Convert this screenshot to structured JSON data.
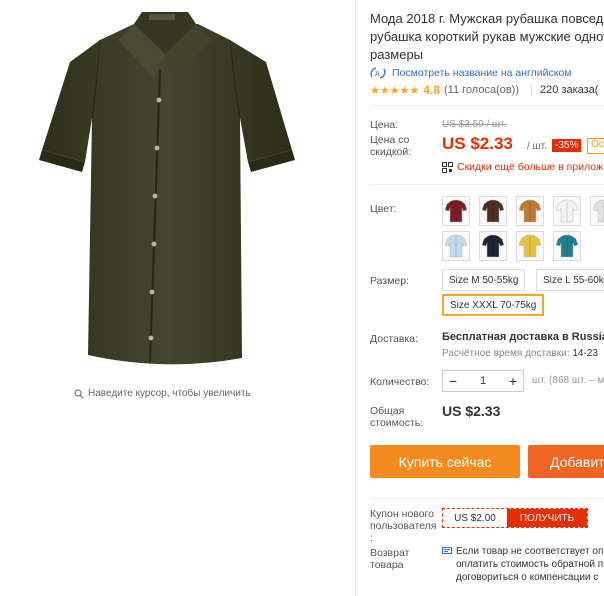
{
  "product": {
    "title_lines": [
      "Мода 2018 г. Мужская рубашка повседн",
      "рубашка короткий рукав мужские однот",
      "размеры"
    ],
    "view_english_label": "Посмотреть название на английском",
    "rating": "4.8",
    "votes": "(11 голоса(ов))",
    "orders": "220 заказа("
  },
  "gallery": {
    "zoom_hint": "Наведите курсор, чтобы увеличить"
  },
  "price": {
    "price_label": "Цена:",
    "original_price": "US $3.59 / шт.",
    "discount_price_label": "Цена со скидкой:",
    "current_price": "US $2.33",
    "unit": "/ шт.",
    "discount_badge": "-35%",
    "coupon_tag": "Ос",
    "more_discounts": "Скидки ещё больше в прилож"
  },
  "options": {
    "color_label": "Цвет:",
    "colors": [
      {
        "name": "burgundy",
        "color": "#7a1e28"
      },
      {
        "name": "brown",
        "color": "#4a3020"
      },
      {
        "name": "camel",
        "color": "#c07830"
      },
      {
        "name": "white",
        "color": "#f2f2f2"
      },
      {
        "name": "light-gray",
        "color": "#e0e0e0"
      },
      {
        "name": "mint",
        "color": "#8fbf9f"
      },
      {
        "name": "light-blue",
        "color": "#c4d8ee"
      },
      {
        "name": "navy",
        "color": "#1c2438"
      },
      {
        "name": "yellow",
        "color": "#e3c23c"
      },
      {
        "name": "teal",
        "color": "#1f7f8f"
      }
    ],
    "size_label": "Размер:",
    "sizes": [
      "Size M 50-55kg",
      "Size L 55-60kg",
      "Size XXXL 70-75kg"
    ],
    "selected_size": "Size XXXL 70-75kg"
  },
  "shipping": {
    "label": "Доставка:",
    "method": "Бесплатная доставка в Russian F",
    "estimated_label": "Расчётное время доставки:",
    "estimated_value": "14-23"
  },
  "quantity": {
    "label": "Количество:",
    "value": "1",
    "available": "шт. (868 шт. – м"
  },
  "total": {
    "label": "Общая стоимость:",
    "value": "US $2.33"
  },
  "actions": {
    "buy_now": "Купить сейчас",
    "add_to_cart": "Добавить"
  },
  "new_user_coupon": {
    "label": "Купон нового пользователя :",
    "amount": "US $2.00",
    "get_button": "ПОЛУЧИТЬ"
  },
  "returns": {
    "label": "Возврат товара",
    "text_lines": [
      "Если товар не соответствует оп",
      "оплатить стоимость обратной п",
      "договориться о компенсации с"
    ]
  },
  "colors": {
    "accent": "#e62e04",
    "buy_button": "#f58b1f",
    "cart_button": "#f26522",
    "link": "#2f6fd4",
    "star": "#f5a623",
    "shirt": "#3e3f27"
  }
}
